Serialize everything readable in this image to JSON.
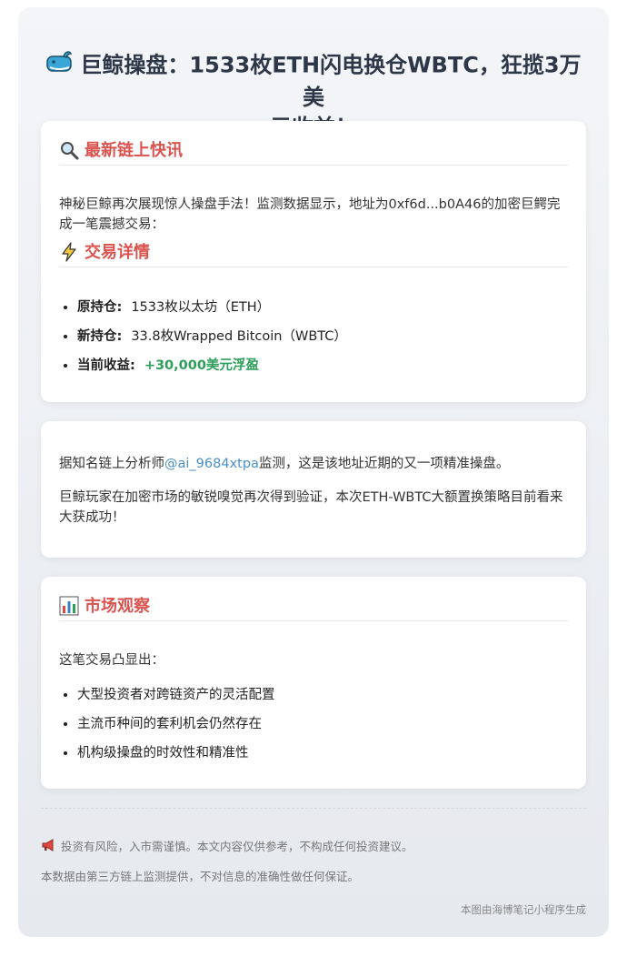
{
  "header": {
    "title_line1": "巨鲸操盘：1533枚ETH闪电换仓WBTC，狂揽3万美",
    "title_line2": "元收益！",
    "icon": "whale-icon"
  },
  "news": {
    "heading": "最新链上快讯",
    "icon": "magnifier-icon",
    "paragraph": "神秘巨鲸再次展现惊人操盘手法！监测数据显示，地址为0xf6d...b0A46的加密巨鳄完成一笔震撼交易："
  },
  "trade": {
    "heading": "交易详情",
    "icon": "lightning-icon",
    "items": [
      {
        "label": "原持仓:",
        "value": "1533枚以太坊（ETH）"
      },
      {
        "label": "新持仓:",
        "value": "33.8枚Wrapped Bitcoin（WBTC）"
      },
      {
        "label": "当前收益:",
        "value": "+30,000美元浮盈"
      }
    ],
    "profit_color": "#2e9e5b"
  },
  "analysis": {
    "p1_prefix": "据知名链上分析师",
    "p1_link": "@ai_9684xtpa",
    "p1_suffix": "监测，这是该地址近期的又一项精准操盘。",
    "p2": "巨鲸玩家在加密市场的敏锐嗅觉再次得到验证，本次ETH-WBTC大额置换策略目前看来大获成功！"
  },
  "market": {
    "heading": "市场观察",
    "icon": "bar-chart-icon",
    "intro": "这笔交易凸显出：",
    "items": [
      "大型投资者对跨链资产的灵活配置",
      "主流币种间的套利机会仍然存在",
      "机构级操盘的时效性和精准性"
    ]
  },
  "footer": {
    "icon": "megaphone-icon",
    "risk": "投资有风险，入市需谨慎。本文内容仅供参考，不构成任何投资建议。",
    "source": "本数据由第三方链上监测提供，不对信息的准确性做任何保证。",
    "credit": "本图由海博笔记小程序生成"
  },
  "colors": {
    "heading": "#d9534f",
    "link": "#4a90c8",
    "title": "#2d3748"
  }
}
